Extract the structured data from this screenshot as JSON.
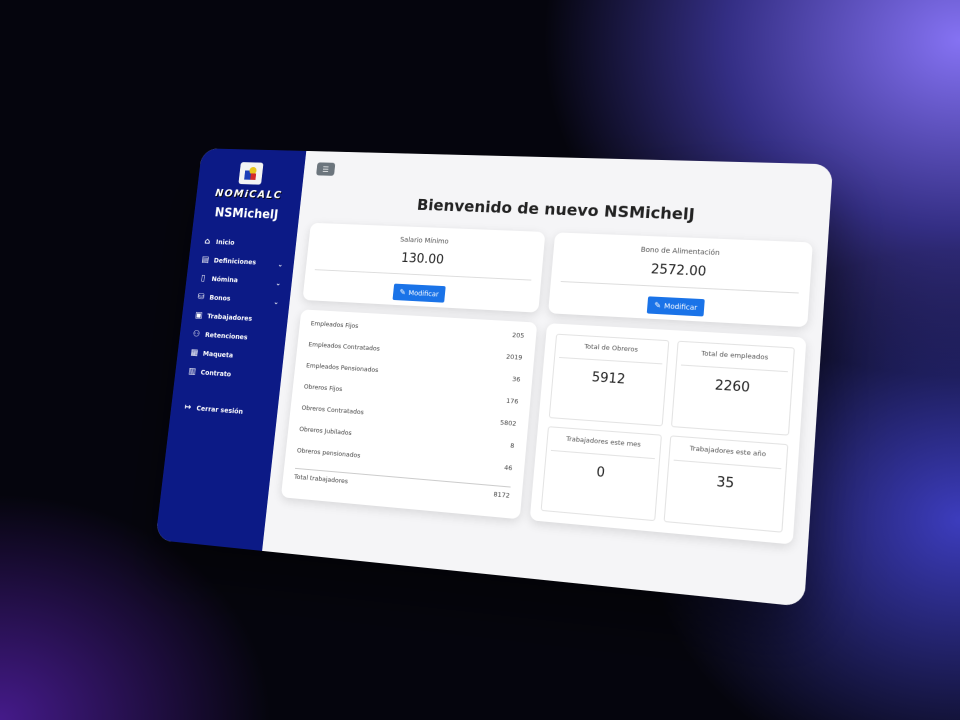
{
  "app": {
    "brand": "NOMiCALC",
    "username": "NSMichelJ"
  },
  "sidebar": {
    "items": [
      {
        "label": "Inicio",
        "icon": "home-icon",
        "glyph": "⌂"
      },
      {
        "label": "Definiciones",
        "icon": "document-icon",
        "glyph": "▤",
        "dropdown": true
      },
      {
        "label": "Nómina",
        "icon": "clipboard-icon",
        "glyph": "▯",
        "dropdown": true
      },
      {
        "label": "Bonos",
        "icon": "coins-icon",
        "glyph": "⛁",
        "dropdown": true
      },
      {
        "label": "Trabajadores",
        "icon": "badge-icon",
        "glyph": "▣"
      },
      {
        "label": "Retenciones",
        "icon": "people-icon",
        "glyph": "⚇"
      },
      {
        "label": "Maqueta",
        "icon": "image-icon",
        "glyph": "▦"
      },
      {
        "label": "Contrato",
        "icon": "contract-icon",
        "glyph": "▥"
      }
    ],
    "logout": {
      "label": "Cerrar sesión",
      "icon": "logout-icon",
      "glyph": "↦"
    },
    "chevron_glyph": "⌄"
  },
  "header": {
    "toggle_glyph": "☰",
    "welcome": "Bienvenido de nuevo NSMichelJ"
  },
  "salary_card": {
    "label": "Salario Mínimo",
    "value": "130.00",
    "button": "Modificar",
    "pen_glyph": "✎"
  },
  "bonus_card": {
    "label": "Bono de Alimentación",
    "value": "2572.00",
    "button": "Modificar",
    "pen_glyph": "✎"
  },
  "employees": [
    {
      "label": "Empleados Fijos",
      "value": "205"
    },
    {
      "label": "Empleados Contratados",
      "value": "2019"
    },
    {
      "label": "Empleados Pensionados",
      "value": "36"
    },
    {
      "label": "Obreros Fijos",
      "value": "176"
    },
    {
      "label": "Obreros Contratados",
      "value": "5802"
    },
    {
      "label": "Obreros Jubilados",
      "value": "8"
    },
    {
      "label": "Obreros pensionados",
      "value": "46"
    },
    {
      "label": "Total trabajadores",
      "value": "8172"
    }
  ],
  "stats": [
    {
      "label": "Total de Obreros",
      "value": "5912"
    },
    {
      "label": "Total de empleados",
      "value": "2260"
    },
    {
      "label": "Trabajadores este mes",
      "value": "0"
    },
    {
      "label": "Trabajadores este año",
      "value": "35"
    }
  ],
  "colors": {
    "sidebar": "#0c1a86",
    "button": "#1a73e8",
    "toggle": "#6c757d"
  }
}
